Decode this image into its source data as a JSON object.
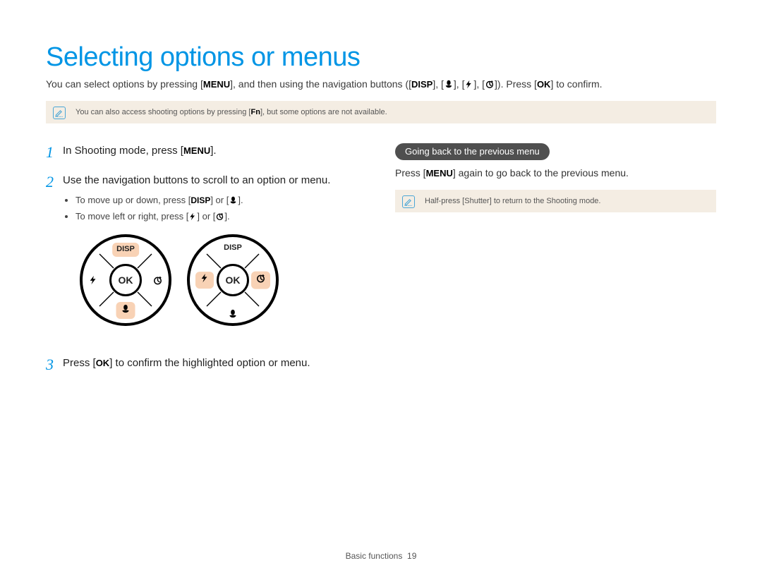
{
  "title": "Selecting options or menus",
  "intro": {
    "t1": "You can select options by pressing [",
    "menu": "MENU",
    "t2": "], and then using the navigation buttons ([",
    "disp": "DISP",
    "t3": "], [",
    "t4": "], [",
    "t5": "], [",
    "t6": "]). Press [",
    "ok": "OK",
    "t7": "] to confirm."
  },
  "note1": {
    "t1": "You can also access shooting options by pressing [",
    "fn": "Fn",
    "t2": "], but some options are not available."
  },
  "steps": [
    {
      "n": "1",
      "t1": "In Shooting mode, press [",
      "menu": "MENU",
      "t2": "]."
    },
    {
      "n": "2",
      "t1": "Use the navigation buttons to scroll to an option or menu.",
      "sub": [
        {
          "a": "To move up or down, press [",
          "disp": "DISP",
          "b": "] or [",
          "c": "]."
        },
        {
          "a": "To move left or right, press [",
          "b": "] or [",
          "c": "]."
        }
      ]
    },
    {
      "n": "3",
      "t1": "Press [",
      "ok": "OK",
      "t2": "] to confirm the highlighted option or menu."
    }
  ],
  "dial": {
    "disp": "DISP",
    "ok": "OK"
  },
  "right": {
    "pill": "Going back to the previous menu",
    "t1": "Press [",
    "menu": "MENU",
    "t2": "] again to go back to the previous menu.",
    "note": {
      "t1": "Half-press [",
      "shutter": "Shutter",
      "t2": "] to return to the Shooting mode."
    }
  },
  "footer": {
    "section": "Basic functions",
    "page": "19"
  }
}
